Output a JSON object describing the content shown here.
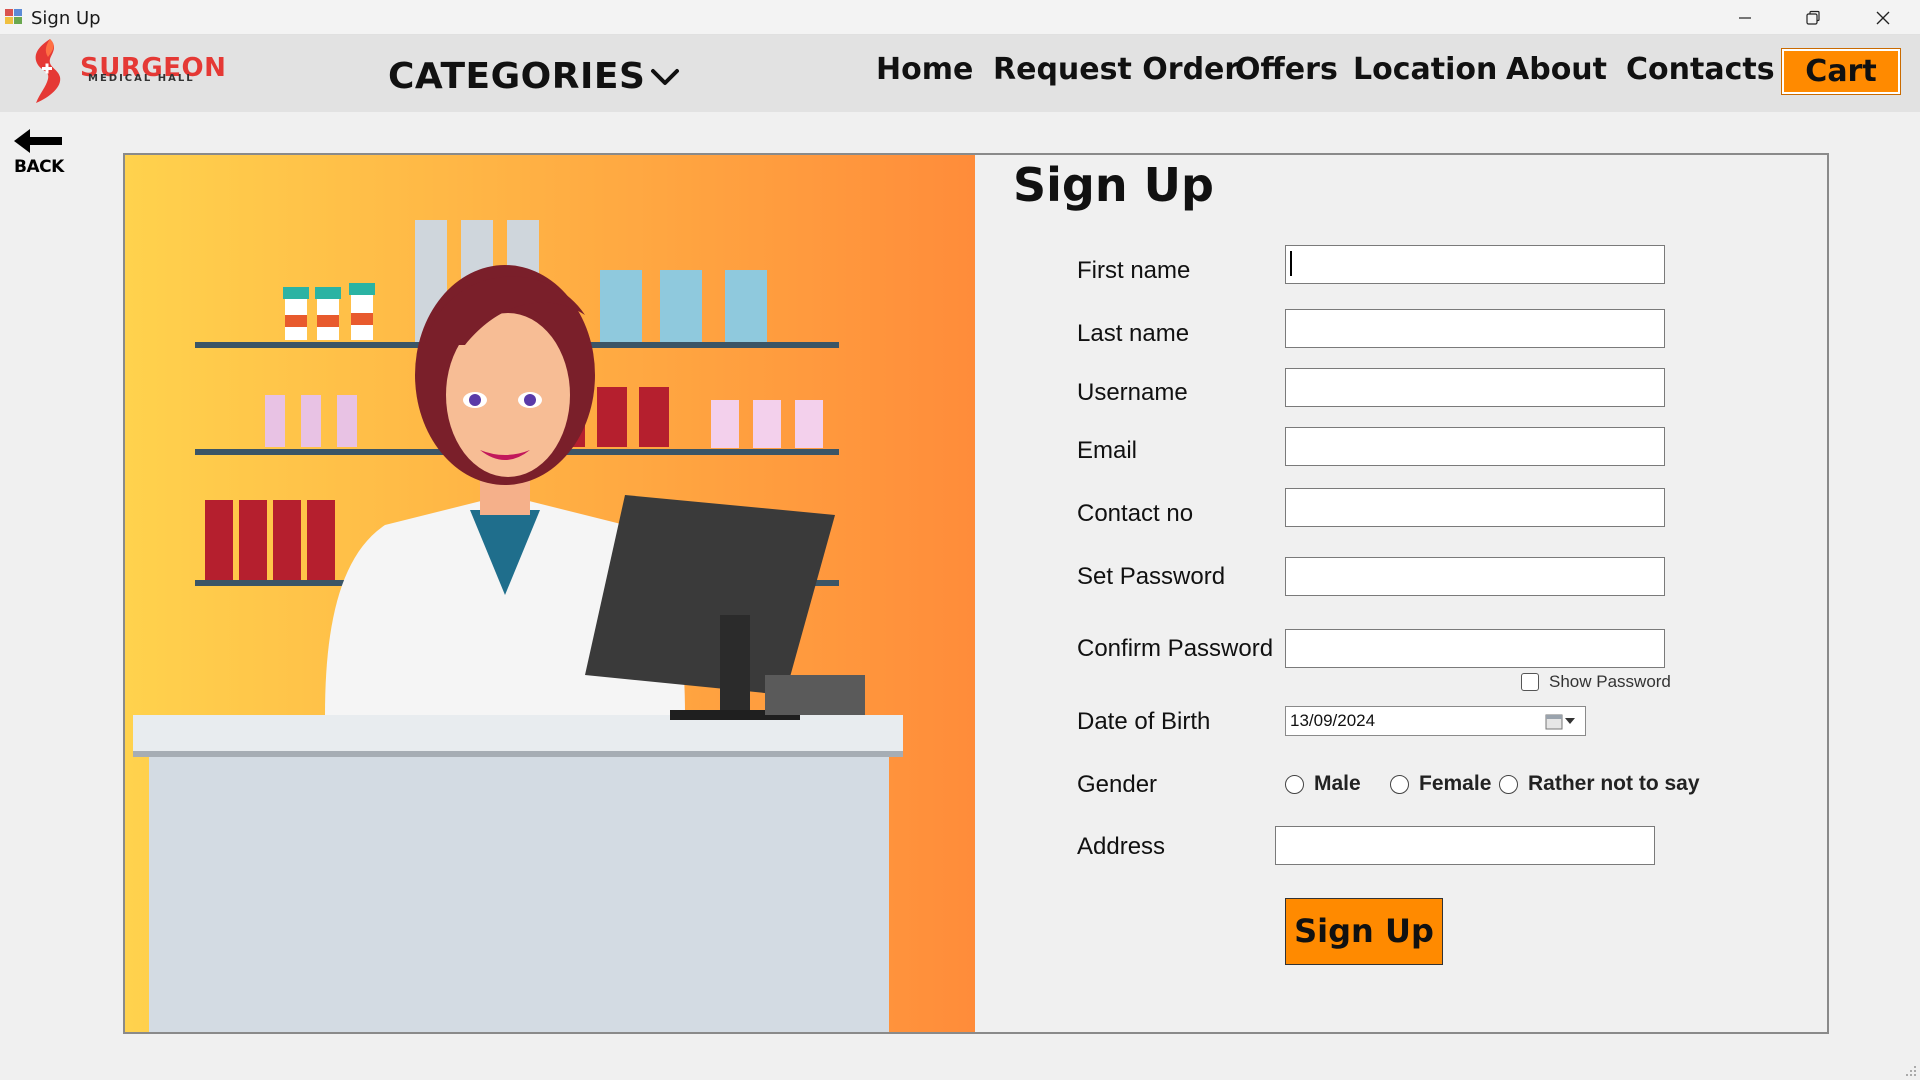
{
  "window": {
    "title": "Sign Up",
    "minimize_icon": "minimize-icon",
    "restore_icon": "restore-icon",
    "close_icon": "close-icon"
  },
  "header": {
    "brand": {
      "name": "SURGEON",
      "tagline": "MEDICAL HALL"
    },
    "categories_label": "CATEGORIES",
    "nav": [
      "Home",
      "Request Order",
      "Offers",
      "Location",
      "About",
      "Contacts"
    ],
    "cart_label": "Cart"
  },
  "back": {
    "label": "BACK"
  },
  "form": {
    "title": "Sign Up",
    "fields": {
      "first_name": {
        "label": "First name",
        "value": ""
      },
      "last_name": {
        "label": "Last name",
        "value": ""
      },
      "username": {
        "label": "Username",
        "value": ""
      },
      "email": {
        "label": "Email",
        "value": ""
      },
      "contact": {
        "label": "Contact no",
        "value": ""
      },
      "password": {
        "label": "Set Password",
        "value": ""
      },
      "confirm_password": {
        "label": "Confirm Password",
        "value": ""
      },
      "dob": {
        "label": "Date of Birth",
        "value": "13/09/2024"
      },
      "gender": {
        "label": "Gender",
        "options": [
          "Male",
          "Female",
          "Rather not to say"
        ]
      },
      "address": {
        "label": "Address",
        "value": ""
      }
    },
    "show_password_label": "Show Password",
    "submit_label": "Sign Up"
  },
  "colors": {
    "accent": "#ff8a00",
    "brand_red": "#e53935",
    "header_bg": "#e2e2e2",
    "page_bg": "#f0f0f0"
  }
}
